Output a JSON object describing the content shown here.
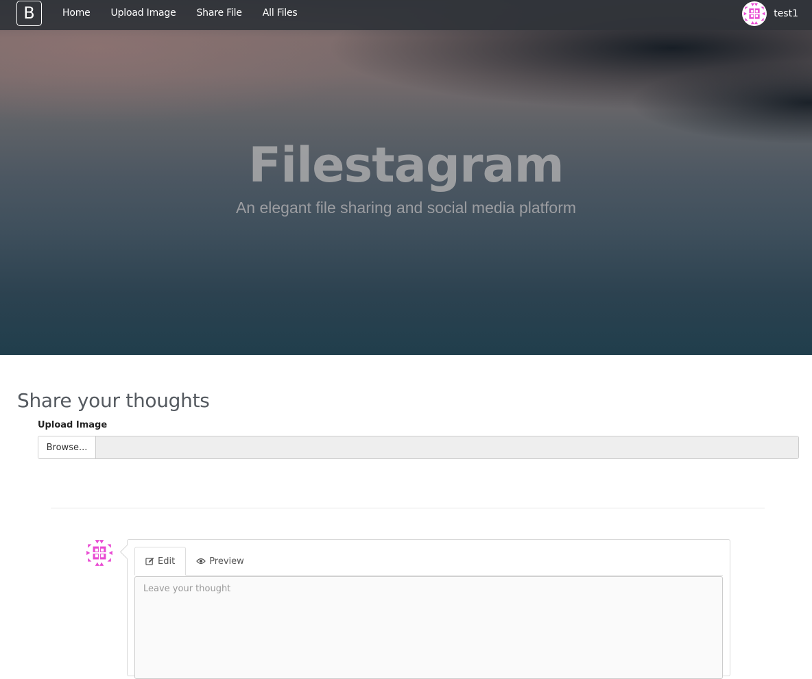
{
  "navbar": {
    "brand_letter": "B",
    "links": [
      "Home",
      "Upload Image",
      "Share File",
      "All Files"
    ],
    "username": "test1",
    "avatar_icon": "identicon-avatar"
  },
  "hero": {
    "title": "Filestagram",
    "subtitle": "An elegant file sharing and social media platform"
  },
  "main": {
    "section_title": "Share your thoughts",
    "upload_label": "Upload Image",
    "browse_label": "Browse..."
  },
  "comment": {
    "tabs": [
      {
        "label": "Edit",
        "icon": "edit-icon",
        "active": true
      },
      {
        "label": "Preview",
        "icon": "eye-icon",
        "active": false
      }
    ],
    "placeholder": "Leave your thought"
  },
  "colors": {
    "identicon": "#e94cd3",
    "navbar": "#303338"
  }
}
